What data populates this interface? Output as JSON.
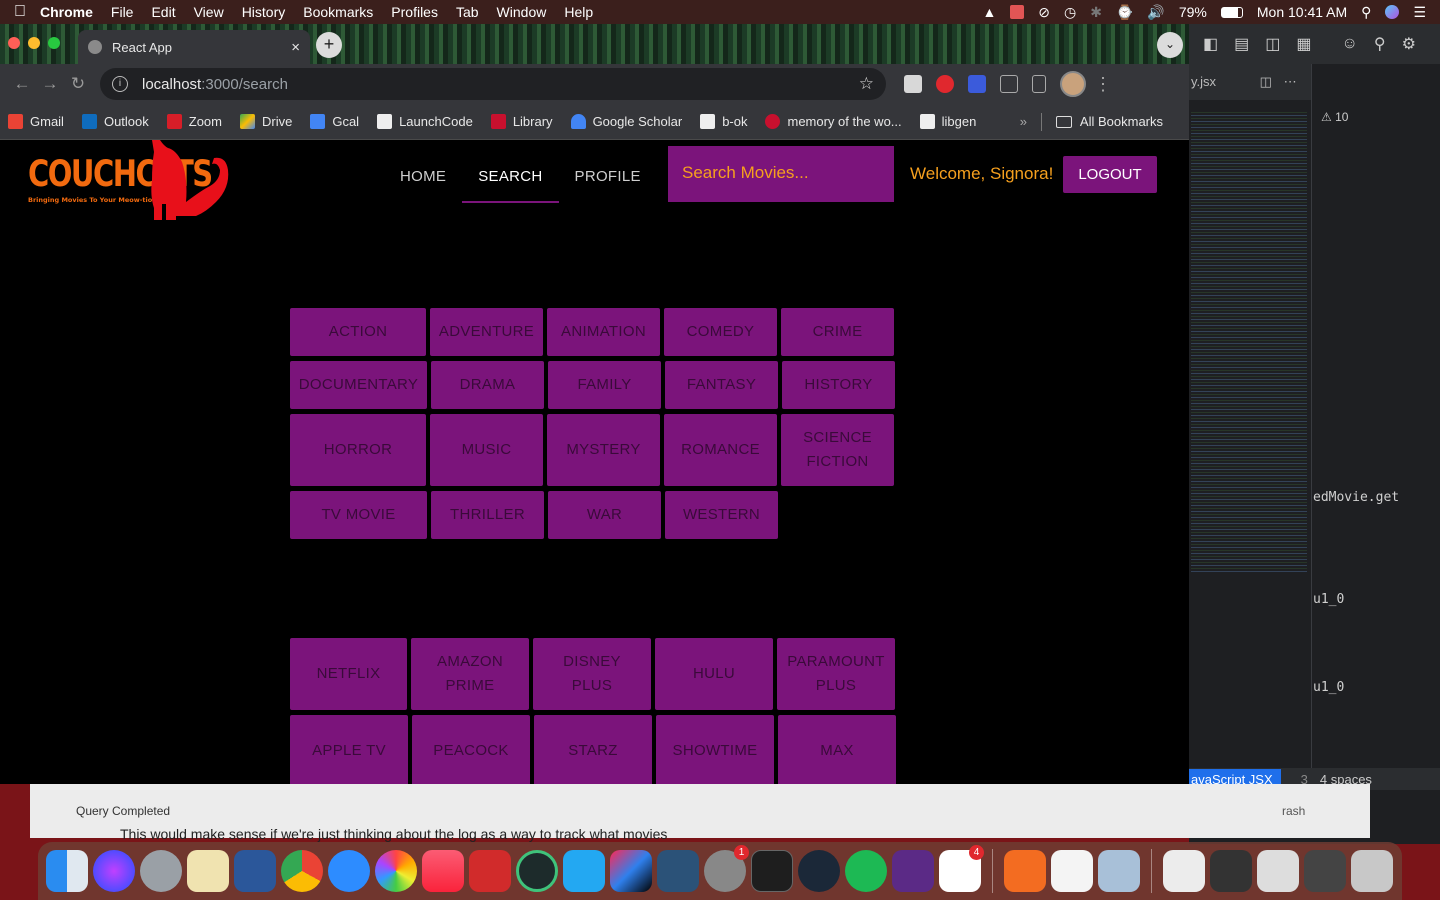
{
  "menubar": {
    "app": "Chrome",
    "items": [
      "File",
      "Edit",
      "View",
      "History",
      "Bookmarks",
      "Profiles",
      "Tab",
      "Window",
      "Help"
    ],
    "battery": "79%",
    "clock": "Mon 10:41 AM"
  },
  "browser": {
    "tab_title": "React App",
    "url_host": "localhost",
    "url_path": ":3000/search",
    "bookmarks": [
      {
        "label": "Gmail",
        "color": "#ea4335"
      },
      {
        "label": "Outlook",
        "color": "#0f6cbd"
      },
      {
        "label": "Zoom",
        "color": "#d71e28"
      },
      {
        "label": "Drive",
        "color": "#fbbc04"
      },
      {
        "label": "Gcal",
        "color": "#4285f4"
      },
      {
        "label": "LaunchCode",
        "color": "#eeeeee"
      },
      {
        "label": "Library",
        "color": "#c8102e"
      },
      {
        "label": "Google Scholar",
        "color": "#4285f4"
      },
      {
        "label": "b-ok",
        "color": "#eeeeee"
      },
      {
        "label": "memory of the wo...",
        "color": "#c8102e"
      },
      {
        "label": "libgen",
        "color": "#eeeeee"
      }
    ],
    "all_bookmarks": "All Bookmarks"
  },
  "app": {
    "logo_title": "COUCHCATS",
    "logo_tagline": "Bringing Movies To Your Meow-tion!",
    "nav": [
      "HOME",
      "SEARCH",
      "PROFILE"
    ],
    "active_nav": "SEARCH",
    "search_placeholder": "Search Movies...",
    "welcome": "Welcome, Signora!",
    "logout": "LOGOUT",
    "genres": [
      "ACTION",
      "ADVENTURE",
      "ANIMATION",
      "COMEDY",
      "CRIME",
      "DOCUMENTARY",
      "DRAMA",
      "FAMILY",
      "FANTASY",
      "HISTORY",
      "HORROR",
      "MUSIC",
      "MYSTERY",
      "ROMANCE",
      "SCIENCE FICTION",
      "TV MOVIE",
      "THRILLER",
      "WAR",
      "WESTERN"
    ],
    "services": [
      "NETFLIX",
      "AMAZON PRIME",
      "DISNEY PLUS",
      "HULU",
      "PARAMOUNT PLUS",
      "APPLE TV",
      "PEACOCK",
      "STARZ",
      "SHOWTIME",
      "MAX"
    ],
    "colors": {
      "accent": "#7b147b",
      "brand": "#f26a0f",
      "welcome": "#f6a01e",
      "cat": "#e8101a"
    }
  },
  "ide": {
    "file_tab": "y.jsx",
    "warnings": "10",
    "code_1": "edMovie.get",
    "code_2": "u1_0",
    "code_3": "u1_0",
    "language": "avaScript JSX",
    "line_num": "3",
    "indent": "4 spaces",
    "status_right": "rash"
  },
  "behind_window": {
    "status": "Query Completed",
    "text": "This would make sense if we're just thinking about the log as a way to track what movies"
  },
  "dock": {
    "badge_settings": "1",
    "badge_slack": "4"
  }
}
